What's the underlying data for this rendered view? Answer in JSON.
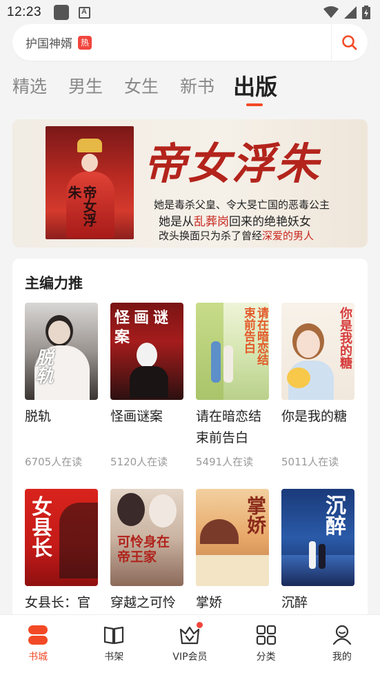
{
  "status_bar": {
    "time": "12:23",
    "notif_icon_letter": "A"
  },
  "search": {
    "placeholder_text": "护国神婿",
    "hot_badge": "热"
  },
  "tabs": [
    "精选",
    "男生",
    "女生",
    "新书",
    "出版"
  ],
  "active_tab_index": 4,
  "banner": {
    "title": "帝女浮朱",
    "cover_title": "帝女浮朱",
    "line1": "她是毒杀父皇、令大旻亡国的恶毒公主",
    "line2_a": "她是从",
    "line2_hl": "乱葬岗",
    "line2_b": "回来的绝艳妖女",
    "line3_a": "改头换面只为杀了曾经",
    "line3_hl": "深爱的男人"
  },
  "section": {
    "title": "主编力推",
    "books": [
      {
        "name": "脱轨",
        "readers": "6705人在读",
        "cover_text": "脱轨"
      },
      {
        "name": "怪画谜案",
        "readers": "5120人在读",
        "cover_text": "怪画谜案"
      },
      {
        "name": "请在暗恋结束前告白",
        "readers": "5491人在读",
        "cover_text": "请在暗恋结束前告白"
      },
      {
        "name": "你是我的糖",
        "readers": "5011人在读",
        "cover_text": "你是我的糖"
      },
      {
        "name": "女县长：官",
        "readers": "",
        "cover_text": "女县长"
      },
      {
        "name": "穿越之可怜",
        "readers": "",
        "cover_text": "可怜身在帝王家"
      },
      {
        "name": "掌娇",
        "readers": "",
        "cover_text": "掌娇"
      },
      {
        "name": "沉醉",
        "readers": "",
        "cover_text": "沉醉"
      }
    ]
  },
  "bottom_nav": [
    {
      "label": "书城",
      "icon": "bookstore-icon",
      "active": true
    },
    {
      "label": "书架",
      "icon": "bookshelf-icon",
      "active": false
    },
    {
      "label": "VIP会员",
      "icon": "vip-crown-icon",
      "active": false
    },
    {
      "label": "分类",
      "icon": "category-grid-icon",
      "active": false
    },
    {
      "label": "我的",
      "icon": "profile-icon",
      "active": false
    }
  ],
  "colors": {
    "accent": "#f24a26",
    "hot": "#f1453d",
    "banner_title": "#b3241c"
  }
}
